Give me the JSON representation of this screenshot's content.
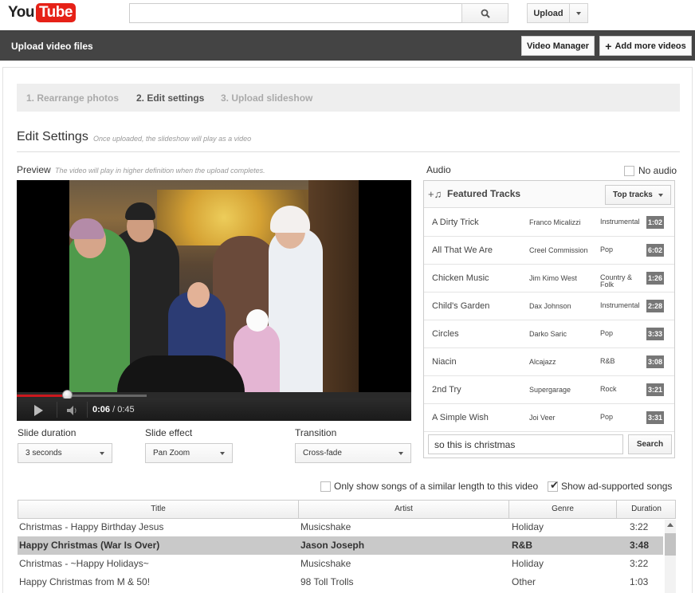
{
  "logo": {
    "you": "You",
    "tube": "Tube"
  },
  "masthead": {
    "search_placeholder": "",
    "upload_label": "Upload"
  },
  "topbar": {
    "title": "Upload video files",
    "video_manager_label": "Video Manager",
    "add_more_label": "Add more videos"
  },
  "steps": [
    {
      "label": "1. Rearrange photos",
      "state": "done"
    },
    {
      "label": "2. Edit settings",
      "state": "active"
    },
    {
      "label": "3. Upload slideshow",
      "state": "pending"
    }
  ],
  "edit_settings": {
    "title": "Edit Settings",
    "note": "Once uploaded, the slideshow will play as a video"
  },
  "preview": {
    "label": "Preview",
    "note": "The video will play in higher definition when the upload completes.",
    "current_time": "0:06",
    "total_time": "0:45",
    "played_fraction": 0.13,
    "loaded_fraction": 0.33
  },
  "slide_settings": [
    {
      "label": "Slide duration",
      "value": "3 seconds"
    },
    {
      "label": "Slide effect",
      "value": "Pan Zoom"
    },
    {
      "label": "Transition",
      "value": "Cross-fade"
    }
  ],
  "audio": {
    "label": "Audio",
    "no_audio_label": "No audio",
    "featured_title": "Featured Tracks",
    "top_tracks_label": "Top tracks",
    "tracks": [
      {
        "title": "A Dirty Trick",
        "artist": "Franco Micalizzi",
        "genre": "Instrumental",
        "duration": "1:02"
      },
      {
        "title": "All That We Are",
        "artist": "Creel Commission",
        "genre": "Pop",
        "duration": "6:02"
      },
      {
        "title": "Chicken Music",
        "artist": "Jim Kimo West",
        "genre": "Country & Folk",
        "duration": "1:26"
      },
      {
        "title": "Child's Garden",
        "artist": "Dax Johnson",
        "genre": "Instrumental",
        "duration": "2:28"
      },
      {
        "title": "Circles",
        "artist": "Darko Saric",
        "genre": "Pop",
        "duration": "3:33"
      },
      {
        "title": "Niacin",
        "artist": "Alcajazz",
        "genre": "R&B",
        "duration": "3:08"
      },
      {
        "title": "2nd Try",
        "artist": "Supergarage",
        "genre": "Rock",
        "duration": "3:21"
      },
      {
        "title": "A Simple Wish",
        "artist": "Joi Veer",
        "genre": "Pop",
        "duration": "3:31"
      }
    ],
    "search_value": "so this is christmas",
    "search_button": "Search"
  },
  "filters": {
    "similar_length_label": "Only show songs of a similar length to this video",
    "similar_length_checked": false,
    "ad_supported_label": "Show ad-supported songs",
    "ad_supported_checked": true
  },
  "results": {
    "columns": [
      "Title",
      "Artist",
      "Genre",
      "Duration"
    ],
    "rows": [
      {
        "title": "Christmas - Happy Birthday Jesus",
        "artist": "Musicshake",
        "genre": "Holiday",
        "duration": "3:22",
        "selected": false
      },
      {
        "title": "Happy Christmas (War Is Over)",
        "artist": "Jason Joseph",
        "genre": "R&B",
        "duration": "3:48",
        "selected": true
      },
      {
        "title": "Christmas - ~Happy Holidays~",
        "artist": "Musicshake",
        "genre": "Holiday",
        "duration": "3:22",
        "selected": false
      },
      {
        "title": "Happy Christmas from M & 50!",
        "artist": "98 Toll Trolls",
        "genre": "Other",
        "duration": "1:03",
        "selected": false
      }
    ]
  }
}
